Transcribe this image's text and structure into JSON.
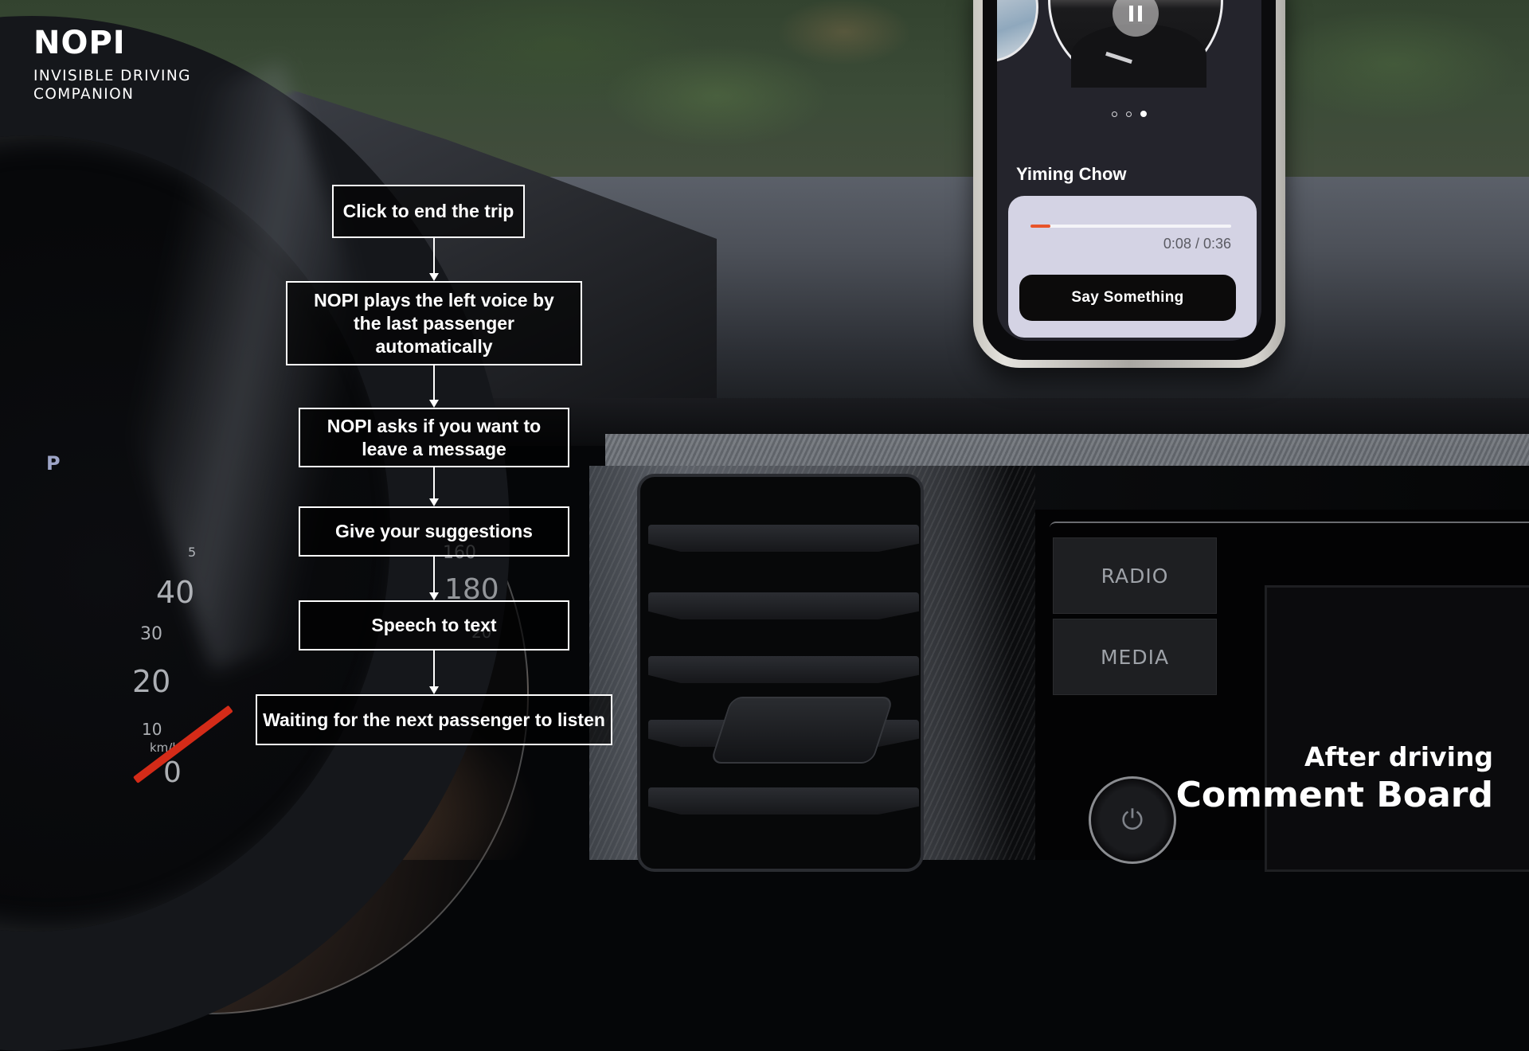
{
  "brand": {
    "title": "NOPI",
    "subtitle_line1": "INVISIBLE DRIVING",
    "subtitle_line2": "COMPANION"
  },
  "flowchart": {
    "steps": [
      {
        "label": "Click to end the trip"
      },
      {
        "label": "NOPI plays the left voice by the last passenger automatically"
      },
      {
        "label": "NOPI asks if you want to leave a message"
      },
      {
        "label": "Give your suggestions"
      },
      {
        "label": "Speech to text"
      },
      {
        "label": "Waiting for the next passenger to listen"
      }
    ]
  },
  "phone": {
    "pause_icon": "pause-icon",
    "carousel": {
      "count": 3,
      "active_index": 2
    },
    "contact_name": "Yiming Chow",
    "player": {
      "progress_fraction": 0.1,
      "elapsed": "0:08",
      "total": "0:36",
      "time_text": "0:08 / 0:36",
      "accent_color": "#e8542a"
    },
    "say_something_label": "Say Something"
  },
  "car": {
    "radio_label": "RADIO",
    "media_label": "MEDIA",
    "power_icon": "power-icon",
    "gear_indicator": "P",
    "speedometer": {
      "labels": [
        "5",
        "40",
        "30",
        "20",
        "10",
        "km/h",
        "0",
        "160",
        "180",
        "20"
      ]
    }
  },
  "caption": {
    "subtitle": "After driving",
    "title": "Comment Board"
  }
}
